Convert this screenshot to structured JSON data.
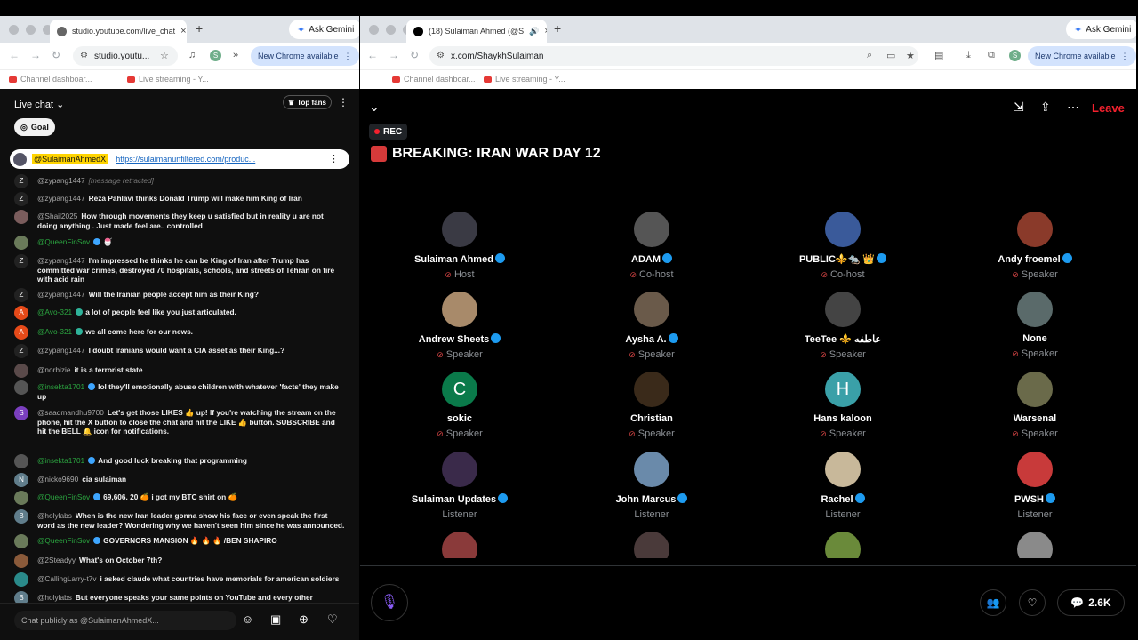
{
  "left_window": {
    "tab": {
      "title": "studio.youtube.com/live_chat",
      "close": "×"
    },
    "new_tab": "+",
    "gemini": "Ask Gemini",
    "nav": {
      "back": "←",
      "forward": "→",
      "reload": "↻",
      "more": "»"
    },
    "omnibox": "studio.youtu...",
    "star": "☆",
    "profile": "S",
    "new_chrome": "New Chrome available",
    "menu": "⋮",
    "bookmarks": [
      "Channel dashboar...",
      "Live streaming - Y..."
    ]
  },
  "chat": {
    "title": "Live chat",
    "top_fans": "Top fans",
    "goal": "Goal",
    "pinned": {
      "user": "@SulaimanAhmedX",
      "link": "https://sulaimanunfiltered.com/produc..."
    },
    "messages": [
      {
        "user": "@zypang1447",
        "text": "[message retracted]",
        "avatar": "Z",
        "color": "#222"
      },
      {
        "user": "@zypang1447",
        "text": "Reza Pahlavi thinks Donald Trump will make him King of Iran",
        "avatar": "Z",
        "color": "#222"
      },
      {
        "user": "@Shail2025",
        "text": "How through movements they keep u satisfied but in reality u are not doing anything . Just made feel are.. controlled",
        "avatar": "",
        "color": "#7a5c5c"
      },
      {
        "user": "@QueenFinSov",
        "text": "🍧",
        "avatar": "",
        "color": "#6a7a5a"
      },
      {
        "user": "@zypang1447",
        "text": "I'm impressed he thinks he can be King of Iran after Trump has committed war crimes, destroyed 70 hospitals, schools, and streets of Tehran on fire with acid rain",
        "avatar": "Z",
        "color": "#222"
      },
      {
        "user": "@zypang1447",
        "text": "Will the Iranian people accept him as their King?",
        "avatar": "Z",
        "color": "#222"
      },
      {
        "user": "@Avo-321",
        "text": "a lot of people feel like you just articulated.",
        "avatar": "A",
        "color": "#e64a19"
      },
      {
        "user": "@Avo-321",
        "text": "we all come here for our news.",
        "avatar": "A",
        "color": "#e64a19"
      },
      {
        "user": "@zypang1447",
        "text": "I doubt Iranians would want a CIA asset as their King...?",
        "avatar": "Z",
        "color": "#222"
      },
      {
        "user": "@norbizie",
        "text": "it is a terrorist state",
        "avatar": "",
        "color": "#5a4a4a"
      },
      {
        "user": "@insekta1701",
        "text": "lol they'll emotionally abuse children with whatever 'facts' they make up",
        "avatar": "",
        "color": "#555"
      },
      {
        "user": "@saadmandhu9700",
        "text": "Let's get those LIKES 👍 up! If you're watching the stream on the phone, hit the X button to close the chat and hit the LIKE 👍 button. SUBSCRIBE and hit the BELL 🔔 icon for notifications.",
        "avatar": "S",
        "color": "#7b3fbf"
      },
      {
        "user": "@insekta1701",
        "text": "And good luck breaking that programming",
        "avatar": "",
        "color": "#555"
      },
      {
        "user": "@nicko9690",
        "text": "cia sulaiman",
        "avatar": "N",
        "color": "#607d8b"
      },
      {
        "user": "@QueenFinSov",
        "text": "69,606. 20 🍊 i got my BTC shirt on 🍊",
        "avatar": "",
        "color": "#6a7a5a"
      },
      {
        "user": "@holylabs",
        "text": "When is the new Iran leader gonna show his face or even speak the first word as the new leader? Wondering why we haven't seen him since he was announced.",
        "avatar": "B",
        "color": "#607d8b"
      },
      {
        "user": "@QueenFinSov",
        "text": "GOVERNORS MANSION 🔥 🔥 🔥 /BEN SHAPIRO",
        "avatar": "",
        "color": "#6a7a5a"
      },
      {
        "user": "@2Steadyy",
        "text": "What's on October 7th?",
        "avatar": "",
        "color": "#8a5a3a"
      },
      {
        "user": "@CallingLarry-t7v",
        "text": "i asked claude what countries have memorials for american soldiers",
        "avatar": "",
        "color": "#2a8a8a"
      },
      {
        "user": "@holylabs",
        "text": "But everyone speaks your same points on YouTube and every other platform.",
        "avatar": "B",
        "color": "#607d8b"
      }
    ],
    "input_placeholder": "Chat publicly as @SulaimanAhmedX..."
  },
  "right_window": {
    "tab": {
      "title": "(18) Sulaiman Ahmed (@S",
      "close": "×"
    },
    "new_tab": "+",
    "gemini": "Ask Gemini",
    "omnibox": "x.com/ShaykhSulaiman",
    "profile": "S",
    "new_chrome": "New Chrome available",
    "menu": "⋮",
    "bookmarks": [
      "Channel dashboar...",
      "Live streaming - Y..."
    ]
  },
  "space": {
    "leave": "Leave",
    "rec": "REC",
    "title": "BREAKING: IRAN WAR DAY 12",
    "participants": [
      {
        "name": "Sulaiman Ahmed",
        "role": "Host",
        "verified": true,
        "initial": "",
        "color": "#3a3a44"
      },
      {
        "name": "ADAM",
        "role": "Co-host",
        "verified": true,
        "initial": "",
        "color": "#555"
      },
      {
        "name": "PUBLIC⚜️🐀 👑",
        "role": "Co-host",
        "verified": true,
        "initial": "",
        "color": "#3a5a9a"
      },
      {
        "name": "Andy froemel",
        "role": "Speaker",
        "verified": true,
        "initial": "",
        "color": "#8a3a2a"
      },
      {
        "name": "Andrew Sheets",
        "role": "Speaker",
        "verified": true,
        "initial": "",
        "color": "#a88a6a"
      },
      {
        "name": "Aysha A.",
        "role": "Speaker",
        "verified": true,
        "initial": "",
        "color": "#6a5a4a"
      },
      {
        "name": "TeeTee ⚜️ عاطفه",
        "role": "Speaker",
        "verified": false,
        "initial": "",
        "color": "#444"
      },
      {
        "name": "None",
        "role": "Speaker",
        "verified": false,
        "initial": "",
        "color": "#5a6a6a"
      },
      {
        "name": "sokic",
        "role": "Speaker",
        "verified": false,
        "initial": "C",
        "color": "#0a7a4a"
      },
      {
        "name": "Christian",
        "role": "Speaker",
        "verified": false,
        "initial": "",
        "color": "#3a2a1a"
      },
      {
        "name": "Hans kaloon",
        "role": "Speaker",
        "verified": false,
        "initial": "H",
        "color": "#3aa0a8"
      },
      {
        "name": "Warsenal",
        "role": "Speaker",
        "verified": false,
        "initial": "",
        "color": "#6a6a4a"
      },
      {
        "name": "Sulaiman Updates",
        "role": "Listener",
        "verified": true,
        "initial": "",
        "color": "#3a2a4a"
      },
      {
        "name": "John Marcus",
        "role": "Listener",
        "verified": true,
        "initial": "",
        "color": "#6a8aaa"
      },
      {
        "name": "Rachel",
        "role": "Listener",
        "verified": true,
        "initial": "",
        "color": "#c8b89a"
      },
      {
        "name": "PWSH",
        "role": "Listener",
        "verified": true,
        "initial": "",
        "color": "#c83a3a"
      },
      {
        "name": "",
        "role": "",
        "verified": false,
        "initial": "",
        "color": "#8a3a3a"
      },
      {
        "name": "",
        "role": "",
        "verified": false,
        "initial": "",
        "color": "#4a3a3a"
      },
      {
        "name": "",
        "role": "",
        "verified": false,
        "initial": "",
        "color": "#6a8a3a"
      },
      {
        "name": "",
        "role": "",
        "verified": false,
        "initial": "",
        "color": "#8a8a8a"
      }
    ],
    "reply_count": "2.6K"
  }
}
